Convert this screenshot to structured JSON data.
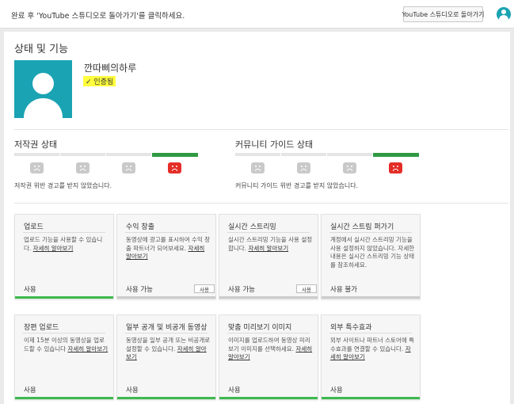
{
  "topbar": {
    "message": "완료 후 'YouTube 스튜디오로 돌아가기'를 클릭하세요.",
    "return_button": "YouTube 스튜디오로 돌아가기"
  },
  "page": {
    "title": "상태 및 기능",
    "channel_name": "깐따삐의하루",
    "verified_label": "인증됨",
    "verified_icon": "✓"
  },
  "copyright": {
    "title": "저작권 상태",
    "text": "저작권 위반 경고를 받지 않았습니다.",
    "active_level": 4,
    "levels": 4
  },
  "community": {
    "title": "커뮤니티 가이드 상태",
    "text": "커뮤니티 가이드 위반 경고를 받지 않았습니다.",
    "active_level": 4,
    "levels": 4
  },
  "cards": [
    {
      "title": "업로드",
      "desc": "업로드 기능을 사용할 수 있습니다. ",
      "link": "자세히 알아보기",
      "status": "사용",
      "enabled": true,
      "button": ""
    },
    {
      "title": "수익 창출",
      "desc": "동영상에 광고를 표시하여 수익 창출 파트너가 되어보세요. ",
      "link": "자세히 알아보기",
      "status": "사용 가능",
      "enabled": false,
      "button": "사용"
    },
    {
      "title": "실시간 스트리밍",
      "desc": "실시간 스트리밍 기능을 사용 설정합니다. ",
      "link": "자세히 알아보기",
      "status": "사용 가능",
      "enabled": false,
      "button": "사용"
    },
    {
      "title": "실시간 스트림 퍼가기",
      "desc": "계정에서 실시간 스트리밍 기능을 사용 설정하지 않았습니다. 자세한 내용은 실시간 스트리밍 기능 상태를 참조하세요.",
      "link": "",
      "status": "사용 불가",
      "enabled": false,
      "button": ""
    },
    {
      "title": "장편 업로드",
      "desc": "이제 15분 이상의 동영상을 업로드할 수 있습니다 ",
      "link": "자세히 알아보기",
      "status": "사용",
      "enabled": true,
      "button": ""
    },
    {
      "title": "일부 공개 및 비공개 동영상",
      "desc": "동영상을 일부 공개 또는 비공개로 설정할 수 있습니다. ",
      "link": "자세히 알아보기",
      "status": "사용",
      "enabled": true,
      "button": ""
    },
    {
      "title": "맞춤 미리보기 이미지",
      "desc": "이미지를 업로드하여 동영상 미리보기 이미지를 선택하세요. ",
      "link": "자세히 알아보기",
      "status": "사용",
      "enabled": true,
      "button": ""
    },
    {
      "title": "외부 특수효과",
      "desc": "외부 사이트나 파트너 스토어에 특수효과를 연결할 수 있습니다. ",
      "link": "자세히 알아보기",
      "status": "사용",
      "enabled": true,
      "button": ""
    }
  ]
}
